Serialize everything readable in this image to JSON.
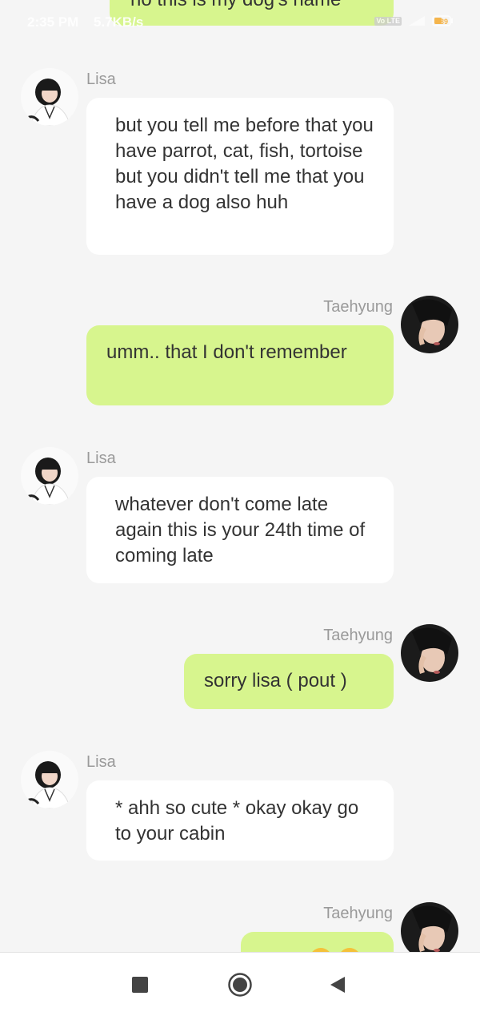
{
  "status_bar": {
    "time": "2:35 PM",
    "speed": "5.7KB/s",
    "battery_level": "39",
    "volte_label": "Vo LTE"
  },
  "chat": {
    "partial_top_message": "no this is my dog's name",
    "messages": [
      {
        "sender": "Lisa",
        "side": "left",
        "text": "but you tell me before that you have parrot, cat, fish, tortoise but you didn't tell me that you have a dog also huh"
      },
      {
        "sender": "Taehyung",
        "side": "right",
        "text": "umm.. that I don't remember"
      },
      {
        "sender": "Lisa",
        "side": "left",
        "text": "whatever don't come late again this is your 24th time of coming late"
      },
      {
        "sender": "Taehyung",
        "side": "right",
        "text": "sorry lisa ( pout )"
      },
      {
        "sender": "Lisa",
        "side": "left",
        "text": "* ahh so cute * okay okay go to your cabin"
      },
      {
        "sender": "Taehyung",
        "side": "right",
        "text": ""
      }
    ]
  },
  "nav_bar": {
    "recents_icon": "square-icon",
    "home_icon": "circle-icon",
    "back_icon": "triangle-back-icon"
  },
  "colors": {
    "background": "#f5f5f5",
    "left_bubble": "#ffffff",
    "right_bubble": "#d7f58e",
    "name_text": "#9a9a9a"
  }
}
